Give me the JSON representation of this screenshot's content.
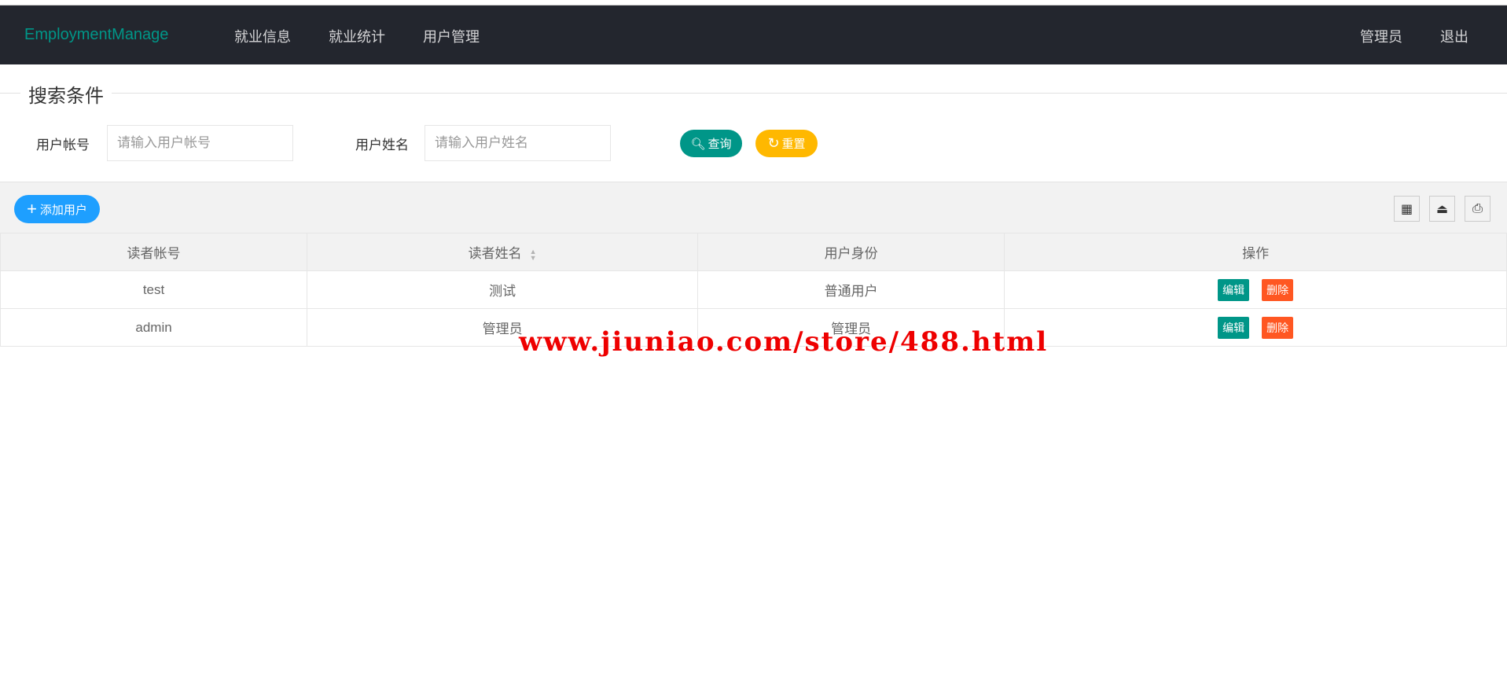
{
  "header": {
    "logo": "EmploymentManage",
    "nav": [
      "就业信息",
      "就业统计",
      "用户管理"
    ],
    "user": "管理员",
    "logout": "退出"
  },
  "search": {
    "legend": "搜索条件",
    "account_label": "用户帐号",
    "account_placeholder": "请输入用户帐号",
    "name_label": "用户姓名",
    "name_placeholder": "请输入用户姓名",
    "query": "查询",
    "reset": "重置"
  },
  "toolbar": {
    "add": "添加用户"
  },
  "table": {
    "headers": [
      "读者帐号",
      "读者姓名",
      "用户身份",
      "操作"
    ],
    "rows": [
      {
        "account": "test",
        "name": "测试",
        "role": "普通用户"
      },
      {
        "account": "admin",
        "name": "管理员",
        "role": "管理员"
      }
    ],
    "edit": "编辑",
    "delete": "删除"
  },
  "colors": {
    "nav": "#23262e",
    "green": "#009688",
    "yellow": "#ffb800",
    "blue": "#1e9fff",
    "red": "#ff5722"
  },
  "watermark": "www.jiuniao.com/store/488.html"
}
